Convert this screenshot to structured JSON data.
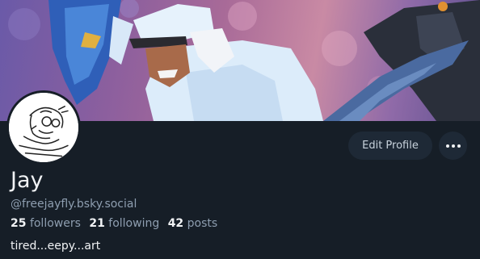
{
  "profile": {
    "display_name": "Jay",
    "handle": "@freejayfly.bsky.social",
    "bio": "tired...eepy...art",
    "stats": {
      "followers_count": "25",
      "followers_label": "followers",
      "following_count": "21",
      "following_label": "following",
      "posts_count": "42",
      "posts_label": "posts"
    }
  },
  "actions": {
    "edit_profile_label": "Edit Profile",
    "more_icon": "ellipsis-icon"
  },
  "colors": {
    "background": "#161e27",
    "button_bg": "#1e2936",
    "muted_text": "#8e9eb0",
    "primary_text": "#f1f3f5"
  }
}
